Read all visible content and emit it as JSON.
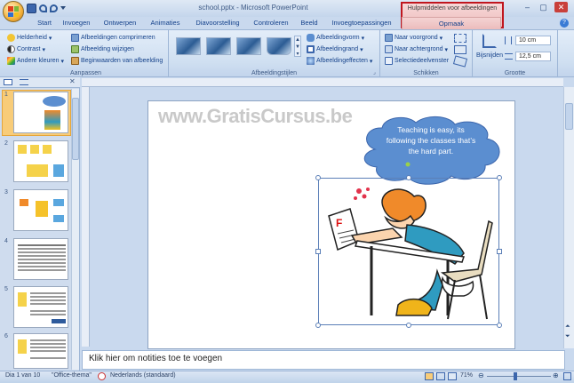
{
  "window": {
    "title": "school.pptx - Microsoft PowerPoint"
  },
  "context_tools": {
    "label": "Hulpmiddelen voor afbeeldingen"
  },
  "tabs": [
    "Start",
    "Invoegen",
    "Ontwerpen",
    "Animaties",
    "Diavoorstelling",
    "Controleren",
    "Beeld",
    "Invoegtoepassingen",
    "Opmaak"
  ],
  "ribbon": {
    "aanpassen": {
      "label": "Aanpassen",
      "helderheid": "Helderheid",
      "contrast": "Contrast",
      "andere_kleuren": "Andere kleuren",
      "comprimeren": "Afbeeldingen comprimeren",
      "wijzigen": "Afbeelding wijzigen",
      "beginwaarden": "Beginwaarden van afbeelding"
    },
    "stijlen": {
      "label": "Afbeeldingstijlen",
      "vorm": "Afbeeldingvorm",
      "rand": "Afbeeldingrand",
      "effecten": "Afbeeldingeffecten"
    },
    "schikken": {
      "label": "Schikken",
      "voorgrond": "Naar voorgrond",
      "achtergrond": "Naar achtergrond",
      "selectie": "Selectiedeelvenster"
    },
    "grootte": {
      "label": "Grootte",
      "bijsnijden": "Bijsnijden",
      "hoogte": "10 cm",
      "breedte": "12,5 cm"
    }
  },
  "slides_pane": {
    "numbers": [
      "1",
      "2",
      "3",
      "4",
      "5",
      "6"
    ]
  },
  "slide": {
    "watermark": "www.GratisCursus.be",
    "bubble_text": "Teaching is easy, its following the classes that’s the hard part.",
    "paper_letter": "F"
  },
  "notes": {
    "placeholder": "Klik hier om notities toe te voegen"
  },
  "status": {
    "slide": "Dia 1 van 10",
    "theme": "\"Office-thema\"",
    "language": "Nederlands (standaard)",
    "zoom": "71%"
  },
  "colors": {
    "context_border": "#c0161e",
    "ribbon": "#cfdff1",
    "bubble": "#5b8ed0"
  }
}
